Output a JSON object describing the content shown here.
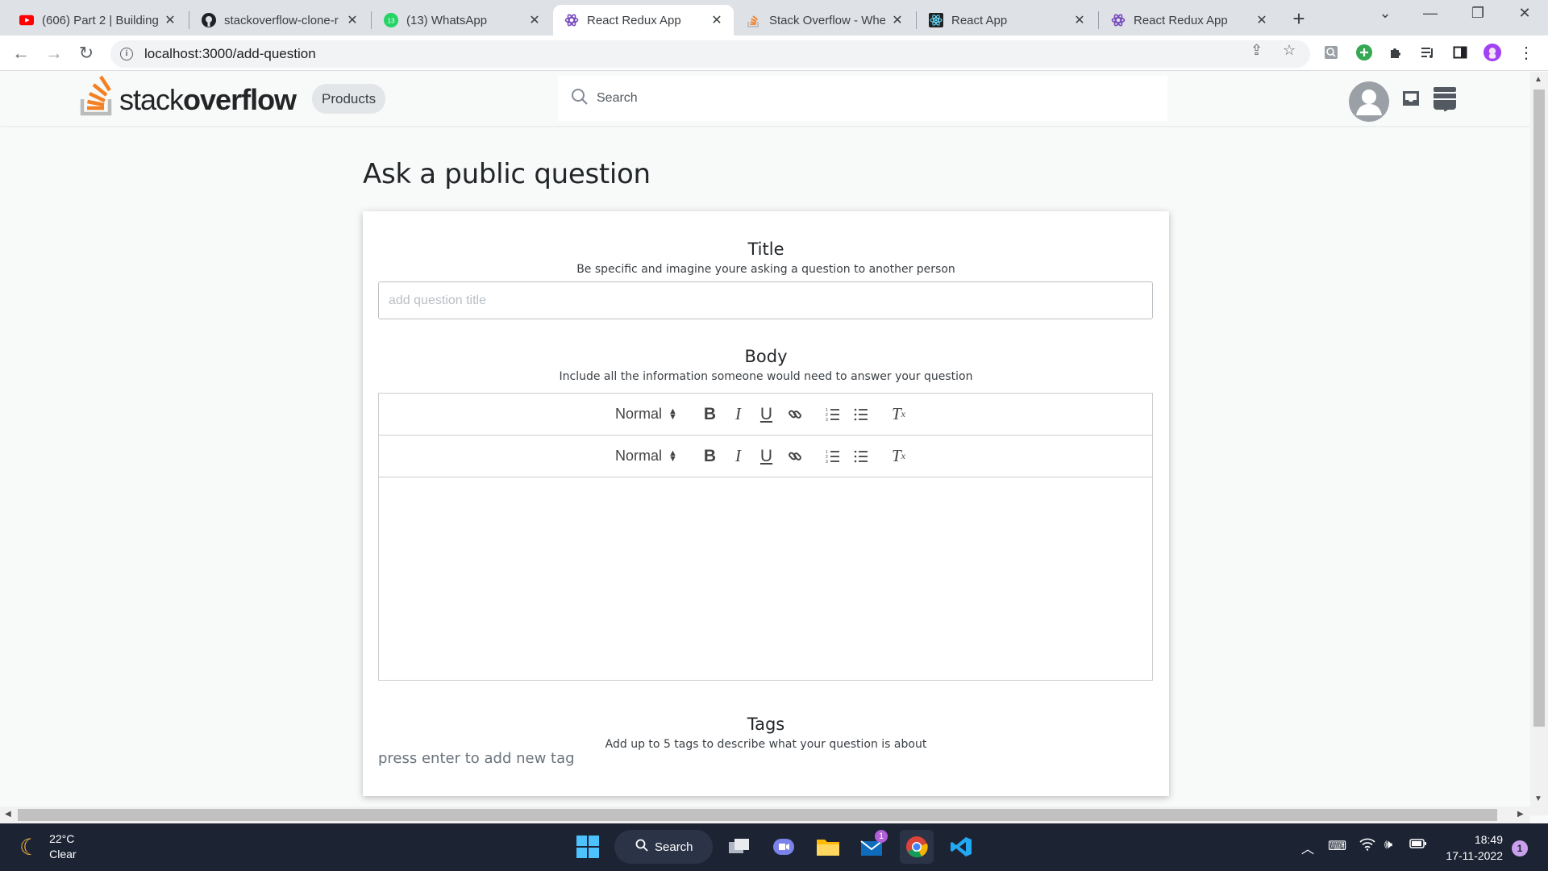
{
  "browser": {
    "tabs": [
      {
        "label": "(606) Part 2 | Building",
        "icon": "youtube-icon",
        "active": false
      },
      {
        "label": "stackoverflow-clone-r",
        "icon": "github-icon",
        "active": false
      },
      {
        "label": "(13) WhatsApp",
        "icon": "whatsapp-icon",
        "badge": "13",
        "active": false
      },
      {
        "label": "React Redux App",
        "icon": "redux-icon",
        "active": true
      },
      {
        "label": "Stack Overflow - Whe",
        "icon": "stackoverflow-icon",
        "active": false
      },
      {
        "label": "React App",
        "icon": "react-icon",
        "active": false
      },
      {
        "label": "React Redux App",
        "icon": "redux-icon",
        "active": false
      }
    ],
    "url": "localhost:3000/add-question"
  },
  "so_header": {
    "logo_light": "stack",
    "logo_bold": "overflow",
    "products_label": "Products",
    "search_placeholder": "Search"
  },
  "page": {
    "title": "Ask a public question",
    "title_section": {
      "heading": "Title",
      "subtitle": "Be specific and imagine youre asking a question to another person",
      "placeholder": "add question title",
      "value": ""
    },
    "body_section": {
      "heading": "Body",
      "subtitle": "Include all the information someone would need to answer your question",
      "toolbar_format": "Normal"
    },
    "tags_section": {
      "heading": "Tags",
      "subtitle": "Add up to 5 tags to describe what your question is about",
      "placeholder": "press enter to add new tag"
    }
  },
  "taskbar": {
    "temperature": "22°C",
    "condition": "Clear",
    "search_label": "Search",
    "mail_badge": "1",
    "time": "18:49",
    "date": "17-11-2022",
    "notification_count": "1"
  },
  "colors": {
    "so_orange": "#f48024",
    "tab_strip": "#dee1e6",
    "taskbar": "#1c2434"
  }
}
